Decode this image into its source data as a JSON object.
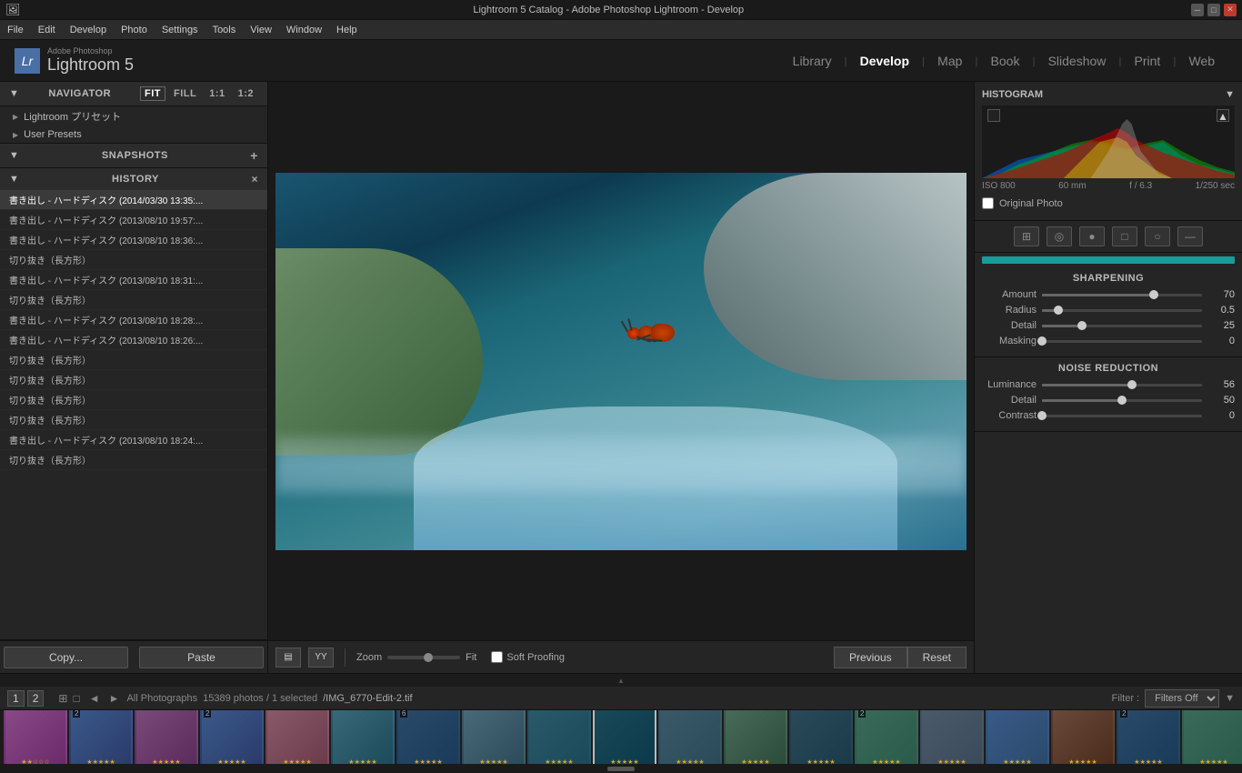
{
  "titlebar": {
    "title": "Lightroom 5 Catalog - Adobe Photoshop Lightroom - Develop",
    "app_icon": "Lr"
  },
  "menubar": {
    "items": [
      "File",
      "Edit",
      "Develop",
      "Photo",
      "Settings",
      "Tools",
      "View",
      "Window",
      "Help"
    ]
  },
  "topnav": {
    "logo_small": "Adobe Photoshop",
    "logo_main": "Lightroom 5",
    "lr_badge": "Lr",
    "modules": [
      {
        "label": "Library",
        "active": false
      },
      {
        "label": "Develop",
        "active": true
      },
      {
        "label": "Map",
        "active": false
      },
      {
        "label": "Book",
        "active": false
      },
      {
        "label": "Slideshow",
        "active": false
      },
      {
        "label": "Print",
        "active": false
      },
      {
        "label": "Web",
        "active": false
      }
    ]
  },
  "navigator": {
    "title": "Navigator",
    "fit_label": "FIT",
    "fill_label": "FILL",
    "one_to_one": "1:1",
    "zoom_label": "1:2"
  },
  "presets": {
    "items": [
      {
        "label": "Lightroom プリセット"
      },
      {
        "label": "User Presets"
      }
    ]
  },
  "snapshots": {
    "title": "Snapshots",
    "add_btn": "+"
  },
  "history": {
    "title": "History",
    "close_btn": "×",
    "items": [
      {
        "label": "書き出し - ハードディスク (2014/03/30 13:35:...",
        "active": true
      },
      {
        "label": "書き出し - ハードディスク (2013/08/10 19:57:..."
      },
      {
        "label": "書き出し - ハードディスク (2013/08/10 18:36:..."
      },
      {
        "label": "切り抜き（長方形）"
      },
      {
        "label": "書き出し - ハードディスク (2013/08/10 18:31:..."
      },
      {
        "label": "切り抜き（長方形）"
      },
      {
        "label": "書き出し - ハードディスク (2013/08/10 18:28:..."
      },
      {
        "label": "書き出し - ハードディスク (2013/08/10 18:26:..."
      },
      {
        "label": "切り抜き（長方形）"
      },
      {
        "label": "切り抜き（長方形）"
      },
      {
        "label": "切り抜き（長方形）"
      },
      {
        "label": "切り抜き（長方形）"
      },
      {
        "label": "書き出し - ハードディスク (2013/08/10 18:24:..."
      },
      {
        "label": "切り抜き（長方形）"
      }
    ]
  },
  "copy_paste": {
    "copy_label": "Copy...",
    "paste_label": "Paste"
  },
  "toolbar": {
    "zoom_label": "Zoom",
    "fit_label": "Fit",
    "soft_proofing_label": "Soft Proofing",
    "previous_label": "Previous",
    "reset_label": "Reset"
  },
  "filmstrip": {
    "collection_label": "All Photographs",
    "count_label": "15389 photos / 1 selected",
    "path_label": "/IMG_6770-Edit-2.tif",
    "filter_label": "Filter :",
    "filter_value": "Filters Off",
    "nav_items": [
      "1",
      "2"
    ],
    "thumbs": [
      {
        "class": "t1",
        "badge": "",
        "stars": "★★☆☆☆"
      },
      {
        "class": "t2",
        "badge": "2",
        "stars": "★★★★★"
      },
      {
        "class": "t3",
        "badge": "",
        "stars": "★★★★★"
      },
      {
        "class": "t4",
        "badge": "2",
        "stars": "★★★★★"
      },
      {
        "class": "t5",
        "badge": "",
        "stars": "★★★★★"
      },
      {
        "class": "t6",
        "badge": "",
        "stars": "★★★★★"
      },
      {
        "class": "t7",
        "badge": "6",
        "stars": "★★★★★"
      },
      {
        "class": "t8",
        "badge": "",
        "stars": "★★★★★"
      },
      {
        "class": "t9",
        "badge": "",
        "stars": "★★★★★"
      },
      {
        "class": "t10",
        "badge": "",
        "stars": "★★★★★",
        "selected": true
      },
      {
        "class": "t11",
        "badge": "",
        "stars": "★★★★★"
      },
      {
        "class": "t12",
        "badge": "",
        "stars": "★★★★★"
      },
      {
        "class": "t13",
        "badge": "",
        "stars": "★★★★★"
      },
      {
        "class": "t14",
        "badge": "2",
        "stars": "★★★★★"
      },
      {
        "class": "t15",
        "badge": "",
        "stars": "★★★★★"
      },
      {
        "class": "t16",
        "badge": "",
        "stars": "★★★★★"
      },
      {
        "class": "t17",
        "badge": "",
        "stars": "★★★★★"
      },
      {
        "class": "t18",
        "badge": "2",
        "stars": "★★★★★"
      },
      {
        "class": "t19",
        "badge": "",
        "stars": "★★★★★"
      }
    ]
  },
  "histogram": {
    "title": "Histogram",
    "iso": "ISO 800",
    "focal": "60 mm",
    "aperture": "f / 6.3",
    "shutter": "1/250 sec",
    "original_photo_label": "Original Photo"
  },
  "sharpening": {
    "title": "Sharpening",
    "amount_label": "Amount",
    "amount_value": "70",
    "amount_pct": 70,
    "radius_label": "Radius",
    "radius_value": "0.5",
    "radius_pct": 10,
    "detail_label": "Detail",
    "detail_value": "25",
    "detail_pct": 25,
    "masking_label": "Masking",
    "masking_value": "0",
    "masking_pct": 0
  },
  "noise_reduction": {
    "title": "Noise Reduction",
    "luminance_label": "Luminance",
    "luminance_value": "56",
    "luminance_pct": 56,
    "detail_label": "Detail",
    "detail_value": "50",
    "detail_pct": 50,
    "contrast_label": "Contrast",
    "contrast_value": "0",
    "contrast_pct": 0
  }
}
